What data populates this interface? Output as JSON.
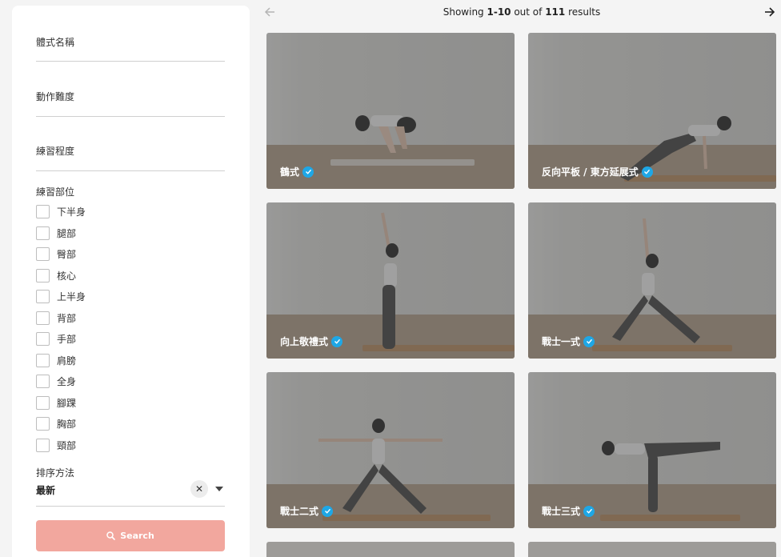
{
  "filters": {
    "pose_name_label": "體式名稱",
    "difficulty_label": "動作難度",
    "level_label": "練習程度",
    "body_parts_title": "練習部位",
    "body_parts": [
      "下半身",
      "腿部",
      "臀部",
      "核心",
      "上半身",
      "背部",
      "手部",
      "肩膀",
      "全身",
      "腳踝",
      "胸部",
      "頸部"
    ],
    "sort_title": "排序方法",
    "sort_value": "最新",
    "clear_symbol": "✕",
    "search_label": "Search"
  },
  "pagination": {
    "prefix": "Showing ",
    "range": "1-10",
    "middle": " out of ",
    "total": "111",
    "suffix": " results"
  },
  "icons": {
    "prev": "arrow-left-icon",
    "next": "arrow-right-icon",
    "search": "search-icon",
    "verified": "check-icon",
    "dropdown": "chevron-down-icon"
  },
  "colors": {
    "accent": "#f2a79e",
    "verified": "#1ea7e6"
  },
  "poses": [
    {
      "name": "鶴式"
    },
    {
      "name": "反向平板 / 東方延展式"
    },
    {
      "name": "向上敬禮式"
    },
    {
      "name": "戰士一式"
    },
    {
      "name": "戰士二式"
    },
    {
      "name": "戰士三式"
    }
  ]
}
